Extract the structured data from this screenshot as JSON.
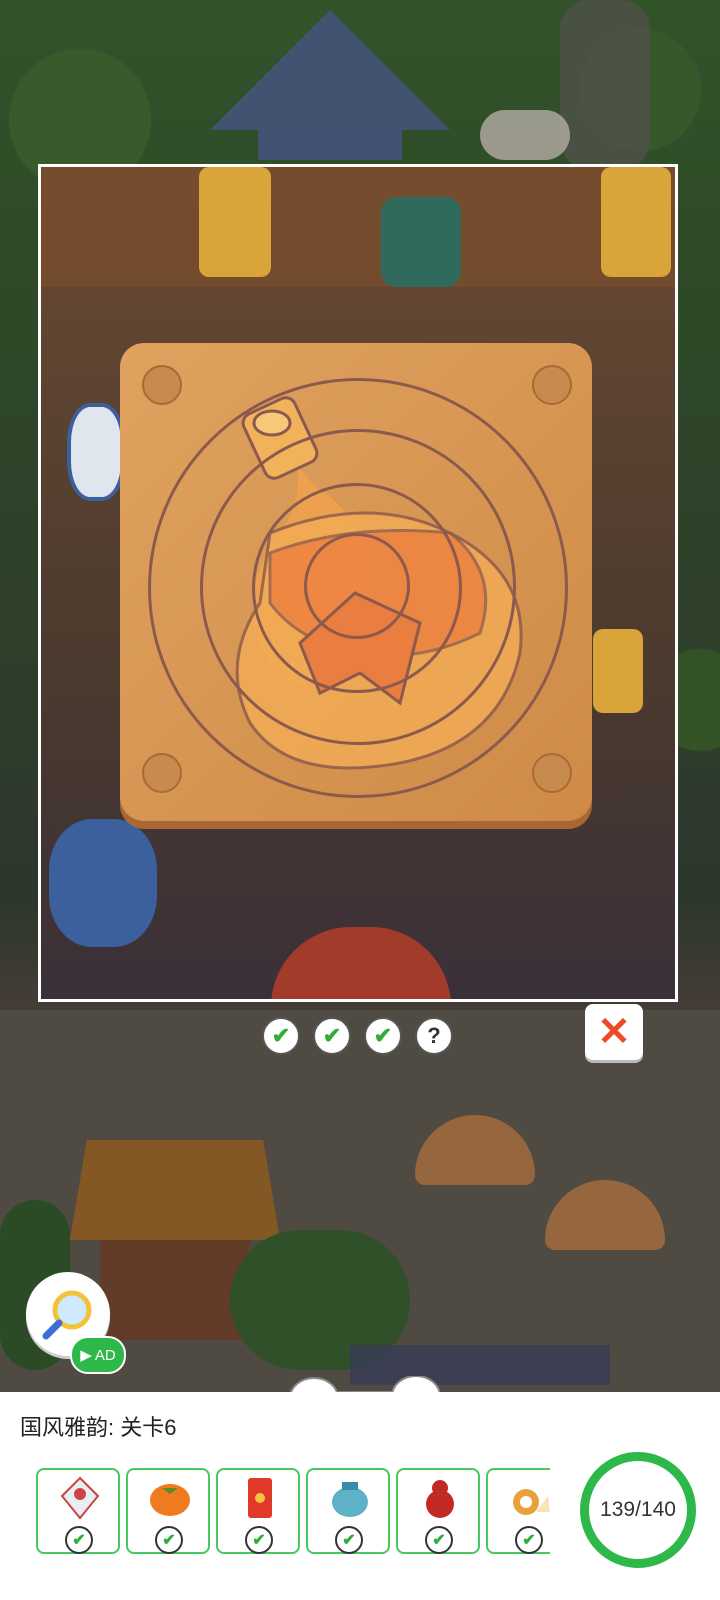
{
  "level": {
    "title": "国风雅韵: 关卡6"
  },
  "progress": {
    "found": 139,
    "total": 140,
    "label": "139/140",
    "fraction": 0.993
  },
  "puzzle": {
    "stage_checks": [
      {
        "state": "done",
        "glyph": "✔"
      },
      {
        "state": "done",
        "glyph": "✔"
      },
      {
        "state": "done",
        "glyph": "✔"
      },
      {
        "state": "unknown",
        "glyph": "?"
      }
    ],
    "close_glyph": "✕"
  },
  "hint": {
    "ad_label": "AD",
    "play_glyph": "▶"
  },
  "items": [
    {
      "icon": "kite-icon",
      "status": "found",
      "glyph": "✔"
    },
    {
      "icon": "persimmon-icon",
      "status": "found",
      "glyph": "✔"
    },
    {
      "icon": "red-envelope-icon",
      "status": "found",
      "glyph": "✔"
    },
    {
      "icon": "blue-jar-icon",
      "status": "found",
      "glyph": "✔"
    },
    {
      "icon": "red-gourd-icon",
      "status": "found",
      "glyph": "✔"
    },
    {
      "icon": "snail-icon",
      "status": "found",
      "glyph": "✔"
    }
  ],
  "colors": {
    "accent_green": "#2fb84a",
    "close_red": "#ec4b2a",
    "board_wood": "#d8975a"
  }
}
